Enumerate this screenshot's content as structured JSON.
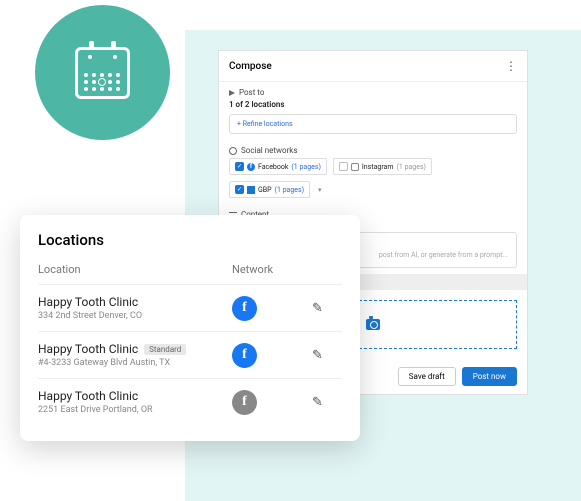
{
  "compose": {
    "title": "Compose",
    "postto_label": "Post to",
    "postto_count": "1 of 2 locations",
    "refine": "+ Refine locations",
    "networks_label": "Social networks",
    "networks": [
      {
        "name": "Facebook",
        "count": "(1 pages)",
        "checked": true
      },
      {
        "name": "Instagram",
        "count": "(1 pages)",
        "checked": false
      },
      {
        "name": "GBP",
        "count": "(1 pages)",
        "checked": true
      }
    ],
    "content_label": "Content",
    "content_placeholder": "post from AI, or generate from a prompt...",
    "save_draft": "Save draft",
    "post_now": "Post now"
  },
  "locations": {
    "title": "Locations",
    "col_location": "Location",
    "col_network": "Network",
    "rows": [
      {
        "name": "Happy Tooth Clinic",
        "badge": "",
        "addr": "334 2nd Street Denver, CO",
        "net": "blue"
      },
      {
        "name": "Happy Tooth Clinic",
        "badge": "Standard",
        "addr": "#4-3233 Gateway Blvd Austin, TX",
        "net": "blue"
      },
      {
        "name": "Happy Tooth Clinic",
        "badge": "",
        "addr": "2251 East Drive Portland, OR",
        "net": "gray"
      }
    ]
  }
}
